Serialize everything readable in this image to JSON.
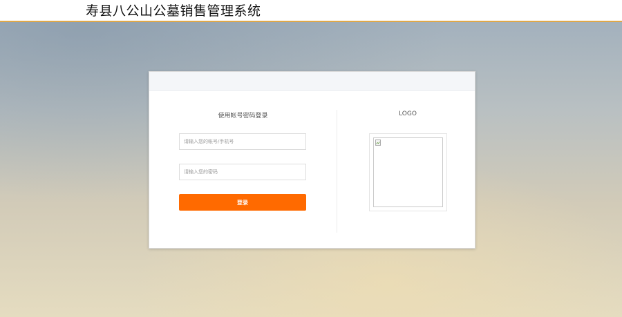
{
  "header": {
    "title": "寿县八公山公墓销售管理系统"
  },
  "login": {
    "title": "使用帐号密码登录",
    "account_placeholder": "请输入您的帐号/手机号",
    "password_placeholder": "请输入您的密码",
    "submit_label": "登录"
  },
  "logo": {
    "title": "LOGO",
    "image_icon": "broken-image-icon"
  },
  "colors": {
    "accent": "#ff6a00",
    "header_border": "#e0a848"
  }
}
